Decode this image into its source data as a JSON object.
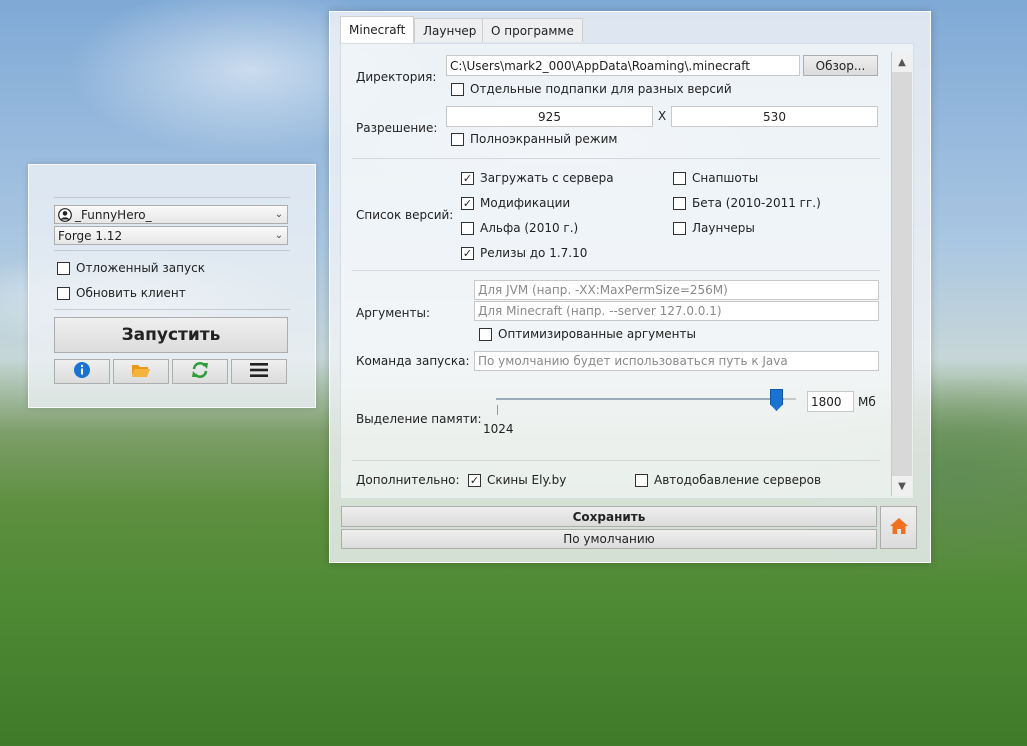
{
  "left_panel": {
    "account": "_FunnyHero_",
    "version": "Forge 1.12",
    "delayed_launch": "Отложенный запуск",
    "update_client": "Обновить клиент",
    "launch_label": "Запустить",
    "icons": [
      "info-icon",
      "folder-icon",
      "refresh-icon",
      "menu-icon"
    ],
    "icon_colors": {
      "info": "#1a73d0",
      "folder": "#f0a020",
      "refresh": "#2e9e3a",
      "menu": "#222222"
    }
  },
  "tabs": [
    "Minecraft",
    "Лаунчер",
    "О программе"
  ],
  "settings": {
    "directory_label": "Директория:",
    "directory_value": "C:\\Users\\mark2_000\\AppData\\Roaming\\.minecraft",
    "browse_label": "Обзор...",
    "separate_folders": "Отдельные подпапки для разных версий",
    "resolution_label": "Разрешение:",
    "width": "925",
    "x_sep": "X",
    "height": "530",
    "fullscreen": "Полноэкранный режим",
    "versions_label": "Список версий:",
    "versions": {
      "from_server": {
        "label": "Загружать с сервера",
        "checked": true
      },
      "mods": {
        "label": "Модификации",
        "checked": true
      },
      "alpha": {
        "label": "Альфа (2010 г.)",
        "checked": false
      },
      "releases": {
        "label": "Релизы до 1.7.10",
        "checked": true
      },
      "snapshots": {
        "label": "Снапшоты",
        "checked": false
      },
      "beta": {
        "label": "Бета (2010-2011 гг.)",
        "checked": false
      },
      "launchers": {
        "label": "Лаунчеры",
        "checked": false
      }
    },
    "arguments_label": "Аргументы:",
    "jvm_placeholder": "Для JVM (напр. -XX:MaxPermSize=256M)",
    "mc_placeholder": "Для Minecraft (напр. --server 127.0.0.1)",
    "optimized_args": "Оптимизированные аргументы",
    "command_label": "Команда запуска:",
    "command_placeholder": "По умолчанию будет использоваться путь к Java",
    "memory_label": "Выделение памяти:",
    "memory_min": "1024",
    "memory_value": "1800",
    "memory_unit": "Мб",
    "memory_fraction": 0.96,
    "extra_label": "Дополнительно:",
    "ely_skins": {
      "label": "Скины Ely.by",
      "checked": true
    },
    "auto_servers": {
      "label": "Автодобавление серверов",
      "checked": false
    },
    "save_label": "Сохранить",
    "default_label": "По умолчанию",
    "home_icon_color": "#f07020"
  }
}
